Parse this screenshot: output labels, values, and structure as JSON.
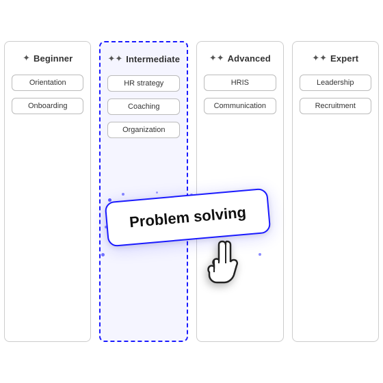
{
  "columns": [
    {
      "id": "beginner",
      "icon": "✦",
      "title": "Beginner",
      "highlighted": false,
      "cards": [
        "Orientation",
        "Onboarding"
      ]
    },
    {
      "id": "intermediate",
      "icon": "✦✦",
      "title": "Intermediate",
      "highlighted": true,
      "cards": [
        "HR strategy",
        "Coaching",
        "Organization"
      ]
    },
    {
      "id": "advanced",
      "icon": "✦✦",
      "title": "Advanced",
      "highlighted": false,
      "cards": [
        "HRIS",
        "Communication"
      ]
    },
    {
      "id": "expert",
      "icon": "✦✦",
      "title": "Expert",
      "highlighted": false,
      "cards": [
        "Leadership",
        "Recruitment"
      ]
    }
  ],
  "dragCard": {
    "label": "Problem solving"
  },
  "cursor": "☞"
}
